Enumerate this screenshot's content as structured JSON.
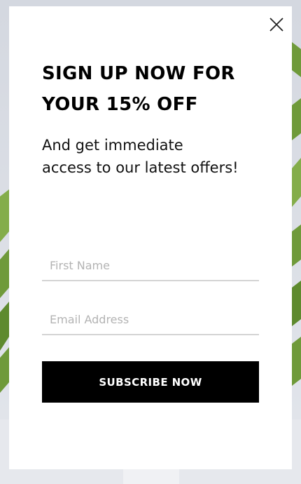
{
  "popup": {
    "headline": "SIGN UP NOW FOR\nYOUR 15% OFF",
    "subtext": "And get immediate\naccess to our latest offers!",
    "first_name_placeholder": "First Name",
    "email_placeholder": "Email Address",
    "subscribe_label": "SUBSCRIBE NOW",
    "close_icon": "close-icon"
  },
  "colors": {
    "button_bg": "#000000",
    "button_text": "#ffffff",
    "leaf_green": "#6f9a3a",
    "backdrop": "#d5d9e1"
  }
}
